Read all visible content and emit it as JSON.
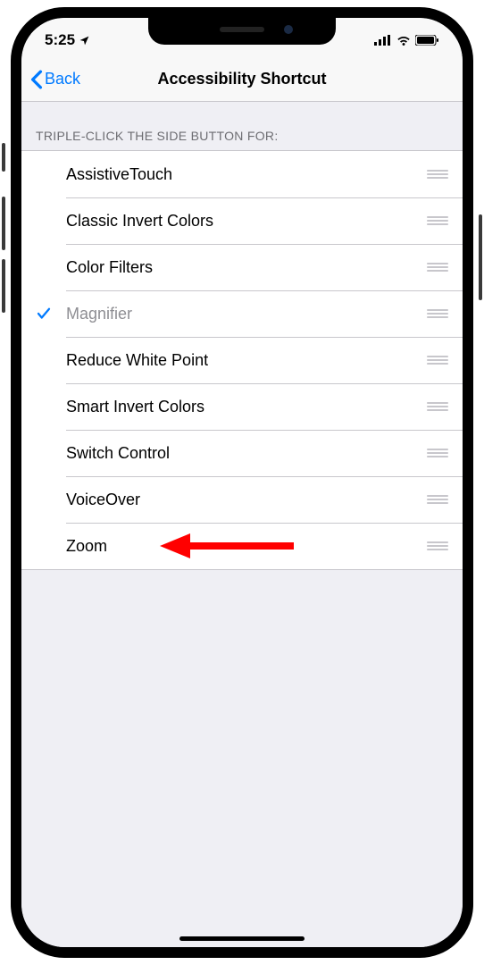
{
  "status": {
    "time": "5:25"
  },
  "nav": {
    "back_label": "Back",
    "title": "Accessibility Shortcut"
  },
  "section_header": "TRIPLE-CLICK THE SIDE BUTTON FOR:",
  "rows": [
    {
      "label": "AssistiveTouch",
      "checked": false
    },
    {
      "label": "Classic Invert Colors",
      "checked": false
    },
    {
      "label": "Color Filters",
      "checked": false
    },
    {
      "label": "Magnifier",
      "checked": true
    },
    {
      "label": "Reduce White Point",
      "checked": false
    },
    {
      "label": "Smart Invert Colors",
      "checked": false
    },
    {
      "label": "Switch Control",
      "checked": false
    },
    {
      "label": "VoiceOver",
      "checked": false
    },
    {
      "label": "Zoom",
      "checked": false
    }
  ],
  "annotation": {
    "arrow_target": "Zoom",
    "color": "#ff0000"
  }
}
